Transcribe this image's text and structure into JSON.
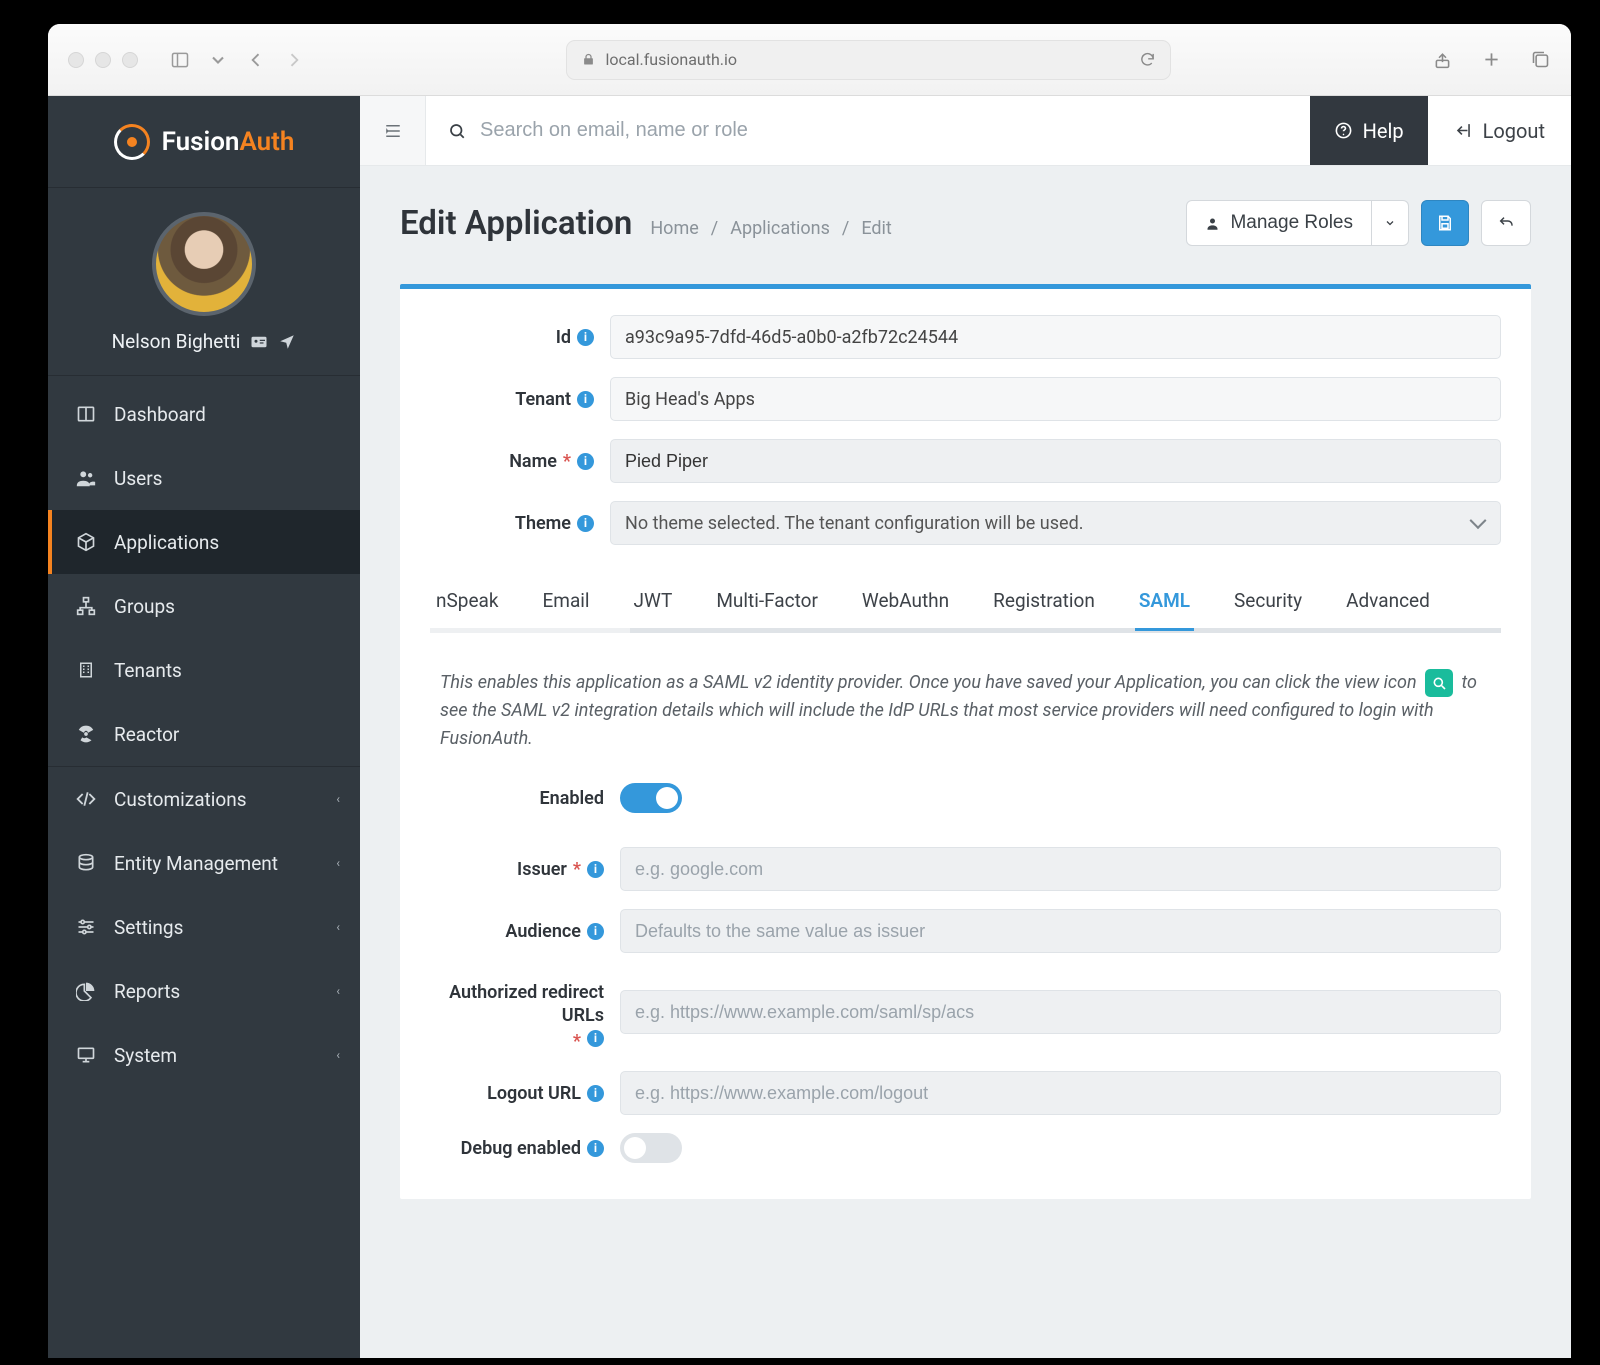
{
  "browser": {
    "url": "local.fusionauth.io"
  },
  "brand": {
    "name_a": "Fusion",
    "name_b": "Auth"
  },
  "profile": {
    "name": "Nelson Bighetti"
  },
  "sidebar": {
    "items": [
      {
        "label": "Dashboard"
      },
      {
        "label": "Users"
      },
      {
        "label": "Applications"
      },
      {
        "label": "Groups"
      },
      {
        "label": "Tenants"
      },
      {
        "label": "Reactor"
      },
      {
        "label": "Customizations"
      },
      {
        "label": "Entity Management"
      },
      {
        "label": "Settings"
      },
      {
        "label": "Reports"
      },
      {
        "label": "System"
      }
    ]
  },
  "topbar": {
    "search_placeholder": "Search on email, name or role",
    "help": "Help",
    "logout": "Logout"
  },
  "page": {
    "title": "Edit Application",
    "crumbs": [
      "Home",
      "Applications",
      "Edit"
    ],
    "manage_roles": "Manage Roles"
  },
  "form": {
    "id_label": "Id",
    "id_value": "a93c9a95-7dfd-46d5-a0b0-a2fb72c24544",
    "tenant_label": "Tenant",
    "tenant_value": "Big Head's Apps",
    "name_label": "Name",
    "name_value": "Pied Piper",
    "theme_label": "Theme",
    "theme_value": "No theme selected. The tenant configuration will be used."
  },
  "tabs": [
    "nSpeak",
    "Email",
    "JWT",
    "Multi-Factor",
    "WebAuthn",
    "Registration",
    "SAML",
    "Security",
    "Advanced"
  ],
  "active_tab": "SAML",
  "saml": {
    "desc_a": "This enables this application as a SAML v2 identity provider. Once you have saved your Application, you can click the view icon ",
    "desc_b": " to see the SAML v2 integration details which will include the IdP URLs that most service providers will need configured to login with FusionAuth.",
    "enabled_label": "Enabled",
    "enabled": true,
    "issuer_label": "Issuer",
    "issuer_placeholder": "e.g. google.com",
    "audience_label": "Audience",
    "audience_placeholder": "Defaults to the same value as issuer",
    "redirect_label": "Authorized redirect URLs",
    "redirect_placeholder": "e.g. https://www.example.com/saml/sp/acs",
    "logout_label": "Logout URL",
    "logout_placeholder": "e.g. https://www.example.com/logout",
    "debug_label": "Debug enabled",
    "debug": false
  }
}
